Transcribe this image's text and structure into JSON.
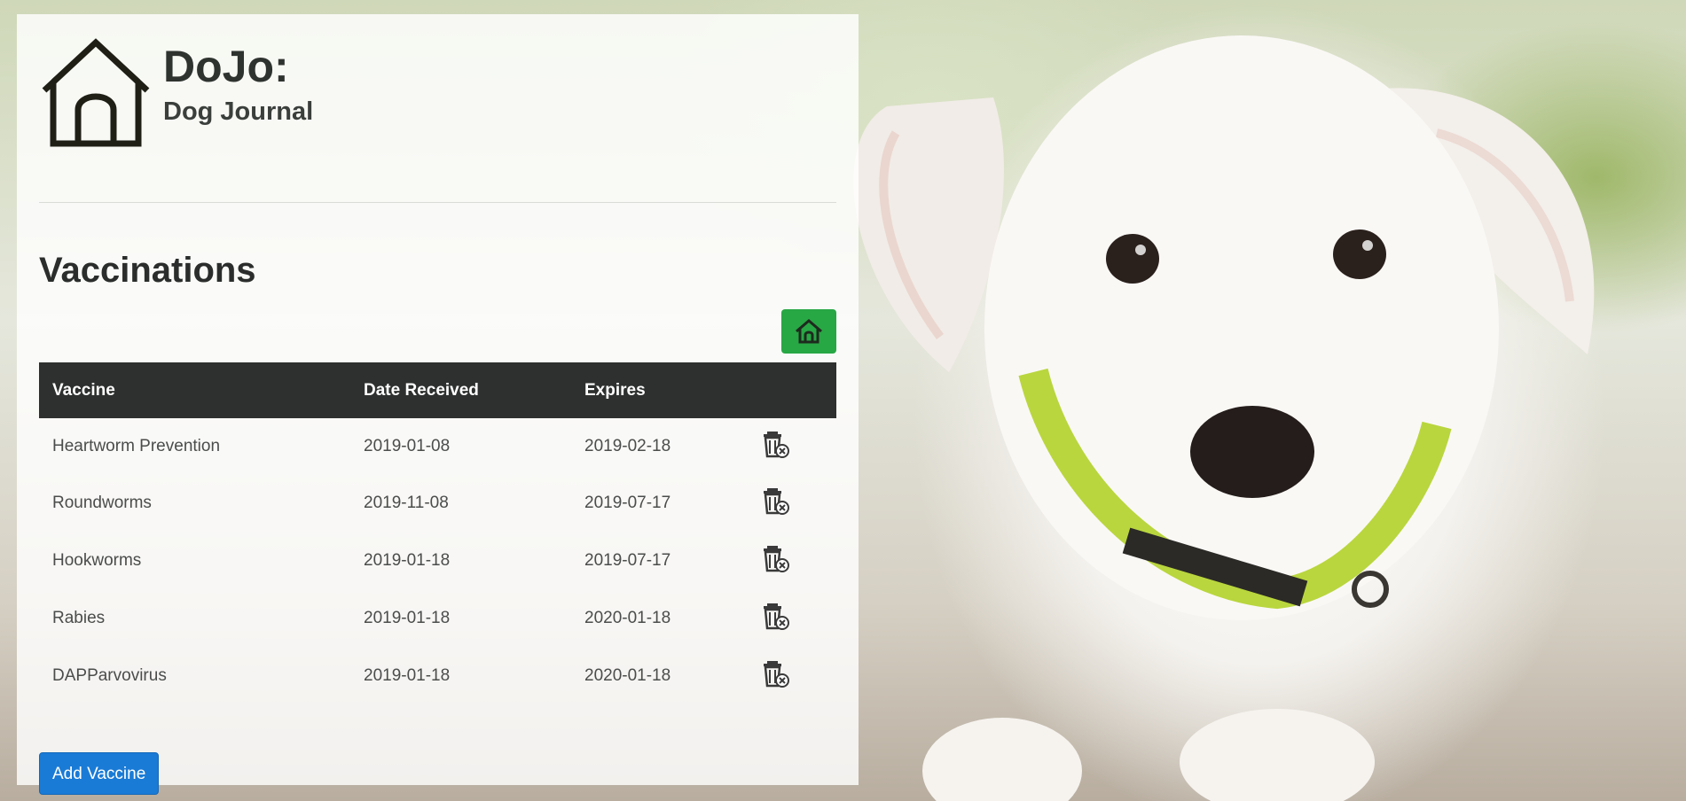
{
  "app": {
    "title": "DoJo:",
    "subtitle": "Dog Journal",
    "logo_icon": "doghouse-icon"
  },
  "page": {
    "heading": "Vaccinations",
    "home_button_icon": "home-icon"
  },
  "table": {
    "columns": [
      "Vaccine",
      "Date Received",
      "Expires",
      ""
    ],
    "rows": [
      {
        "vaccine": "Heartworm Prevention",
        "received": "2019-01-08",
        "expires": "2019-02-18",
        "action_icon": "delete-trash-icon"
      },
      {
        "vaccine": "Roundworms",
        "received": "2019-11-08",
        "expires": "2019-07-17",
        "action_icon": "delete-trash-icon"
      },
      {
        "vaccine": "Hookworms",
        "received": "2019-01-18",
        "expires": "2019-07-17",
        "action_icon": "delete-trash-icon"
      },
      {
        "vaccine": "Rabies",
        "received": "2019-01-18",
        "expires": "2020-01-18",
        "action_icon": "delete-trash-icon"
      },
      {
        "vaccine": "DAPParvovirus",
        "received": "2019-01-18",
        "expires": "2020-01-18",
        "action_icon": "delete-trash-icon"
      }
    ]
  },
  "actions": {
    "add_label": "Add Vaccine"
  },
  "colors": {
    "home_button": "#28a745",
    "add_button": "#1a7bd6",
    "table_header": "#2d302e"
  }
}
